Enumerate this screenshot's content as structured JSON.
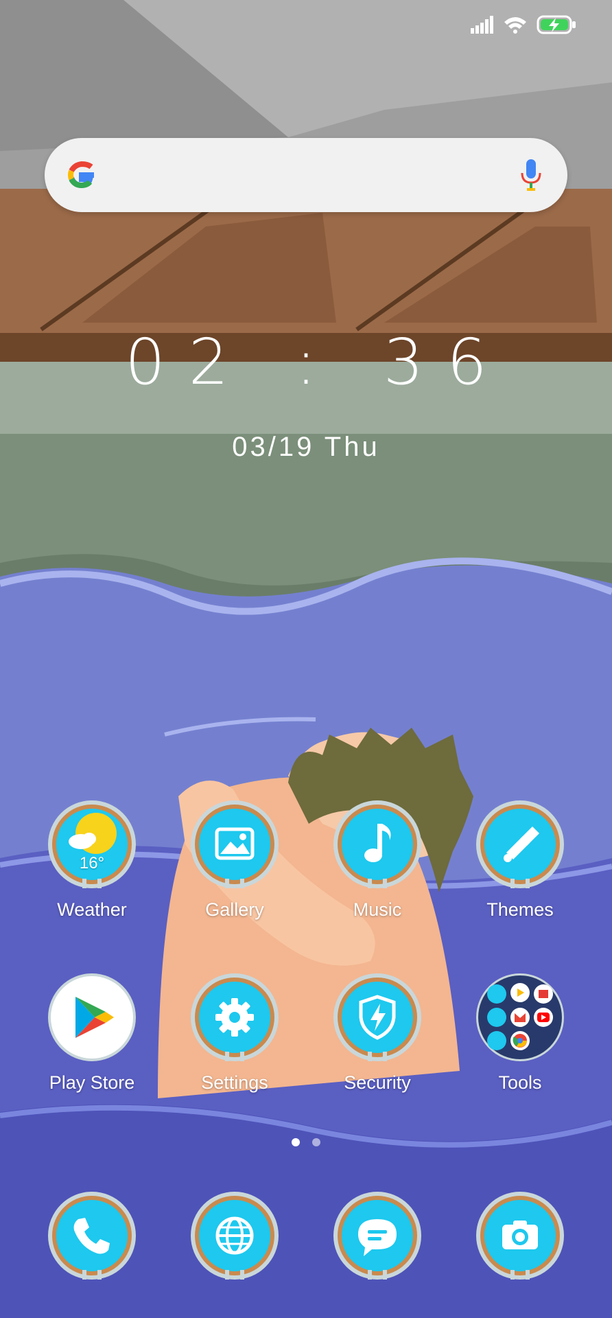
{
  "status_bar": {
    "signal_icon": "cellular-signal-icon",
    "wifi_icon": "wifi-icon",
    "battery_icon": "battery-charging-icon"
  },
  "search": {
    "logo": "google-g-logo",
    "mic_icon": "microphone-icon"
  },
  "clock_widget": {
    "time": "02 : 36",
    "date": "03/19  Thu"
  },
  "apps": {
    "row1": [
      {
        "label": "Weather",
        "icon": "weather-icon",
        "temp": "16°"
      },
      {
        "label": "Gallery",
        "icon": "gallery-icon"
      },
      {
        "label": "Music",
        "icon": "music-note-icon"
      },
      {
        "label": "Themes",
        "icon": "paintbrush-icon"
      }
    ],
    "row2": [
      {
        "label": "Play Store",
        "icon": "play-store-icon"
      },
      {
        "label": "Settings",
        "icon": "gear-icon"
      },
      {
        "label": "Security",
        "icon": "shield-bolt-icon"
      },
      {
        "label": "Tools",
        "icon": "folder-icon"
      }
    ]
  },
  "pager": {
    "pages": 2,
    "current": 1
  },
  "dock": [
    {
      "icon": "phone-icon"
    },
    {
      "icon": "browser-globe-icon"
    },
    {
      "icon": "messages-icon"
    },
    {
      "icon": "camera-icon"
    }
  ],
  "colors": {
    "icon_cyan": "#1ec8ee",
    "icon_ring": "#c98a4e",
    "icon_frame": "#c9d7da",
    "water": "#5a5fc2"
  }
}
